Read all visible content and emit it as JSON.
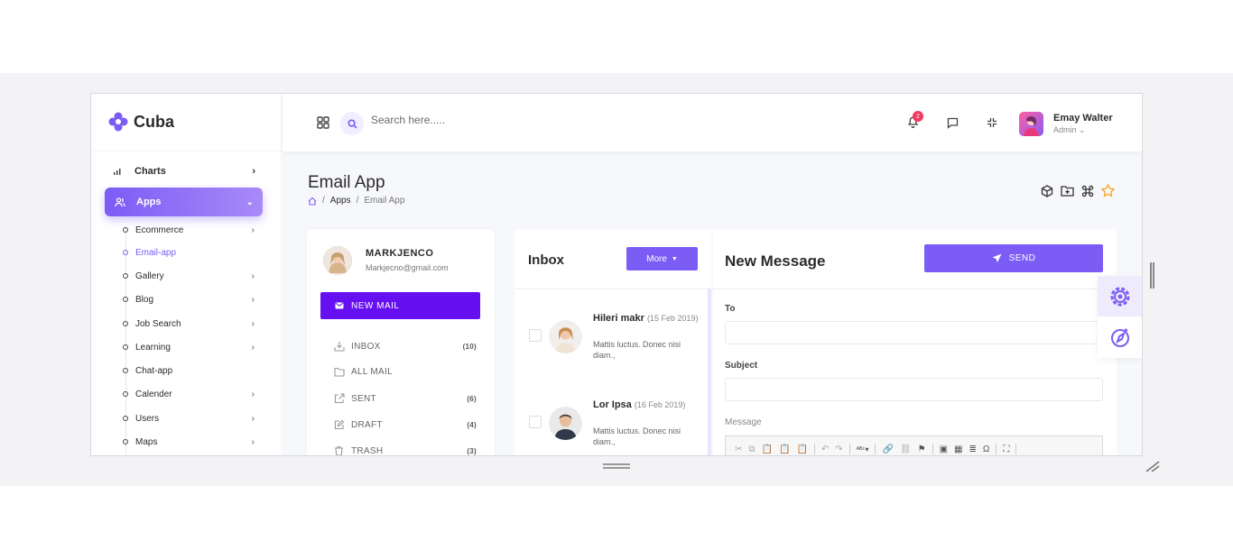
{
  "app": {
    "name": "Cuba"
  },
  "header": {
    "search_placeholder": "Search here.....",
    "notification_count": "2",
    "user_name": "Emay Walter",
    "user_role": "Admin"
  },
  "sidebar": {
    "charts_label": "Charts",
    "apps_label": "Apps",
    "items": [
      {
        "label": "Ecommerce",
        "has_children": true
      },
      {
        "label": "Email-app",
        "has_children": false
      },
      {
        "label": "Gallery",
        "has_children": true
      },
      {
        "label": "Blog",
        "has_children": true
      },
      {
        "label": "Job Search",
        "has_children": true
      },
      {
        "label": "Learning",
        "has_children": true
      },
      {
        "label": "Chat-app",
        "has_children": false
      },
      {
        "label": "Calender",
        "has_children": true
      },
      {
        "label": "Users",
        "has_children": true
      },
      {
        "label": "Maps",
        "has_children": true
      }
    ]
  },
  "page": {
    "title": "Email App",
    "breadcrumb": [
      "Apps",
      "Email App"
    ]
  },
  "profile": {
    "name": "MARKJENCO",
    "email": "Markjecno@gmail.com"
  },
  "new_mail_label": "NEW MAIL",
  "folders": [
    {
      "label": "INBOX",
      "count": "(10)",
      "icon": "inbox-icon"
    },
    {
      "label": "ALL MAIL",
      "count": "",
      "icon": "folder-icon"
    },
    {
      "label": "SENT",
      "count": "(6)",
      "icon": "sent-icon"
    },
    {
      "label": "DRAFT",
      "count": "(4)",
      "icon": "draft-icon"
    },
    {
      "label": "TRASH",
      "count": "(3)",
      "icon": "trash-icon"
    }
  ],
  "inbox": {
    "title": "Inbox",
    "more_label": "More",
    "mails": [
      {
        "name": "Hileri makr",
        "date": "(15 Feb 2019)",
        "snippet": "Mattis luctus. Donec nisi diam.,"
      },
      {
        "name": "Lor Ipsa",
        "date": "(16 Feb 2019)",
        "snippet": "Mattis luctus. Donec nisi diam.,"
      }
    ]
  },
  "compose": {
    "title": "New Message",
    "send_label": "SEND",
    "to_label": "To",
    "subject_label": "Subject",
    "message_label": "Message"
  },
  "colors": {
    "accent": "#7b5cf5",
    "new_mail": "#6610f2",
    "badge": "#f13a5f"
  }
}
